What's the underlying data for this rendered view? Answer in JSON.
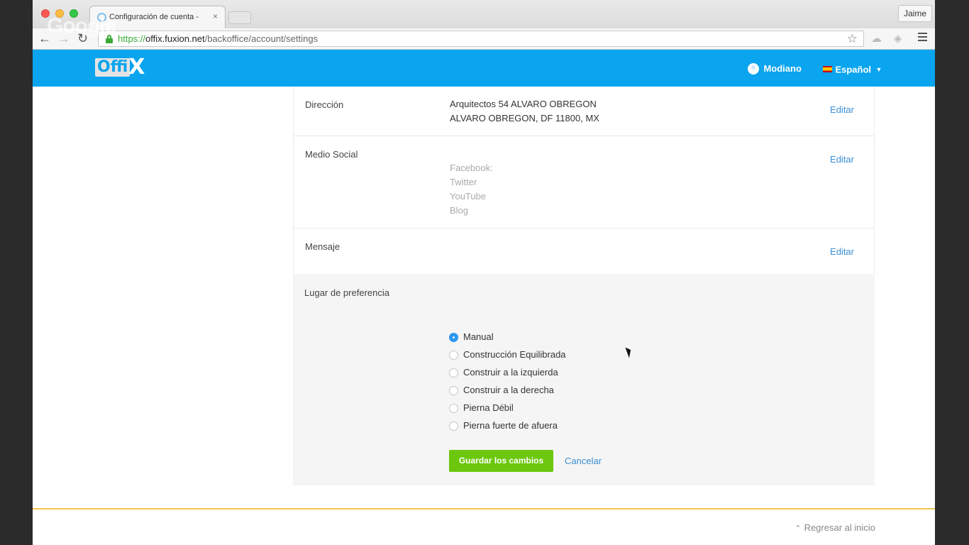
{
  "browser": {
    "tab_title": "Configuración de cuenta -",
    "tab_close": "×",
    "profile_name": "Jaime",
    "url_scheme": "https://",
    "url_host": "offix.fuxion.net",
    "url_path": "/backoffice/account/settings",
    "icons": [
      "back-icon",
      "forward-icon",
      "reload-icon",
      "lock-icon",
      "star-icon",
      "menu-icon"
    ]
  },
  "watermark": "Google",
  "header": {
    "logo_text_a": "Offi",
    "logo_text_b": "X",
    "user_name": "Modiano",
    "language": "Español",
    "accent_color": "#0aa4ef"
  },
  "account": {
    "address": {
      "label": "Dirección",
      "line1": "Arquitectos 54 ALVARO OBREGON",
      "line2": "ALVARO OBREGON, DF 11800, MX",
      "edit": "Editar"
    },
    "social": {
      "label": "Medio Social",
      "items": [
        "Facebook:",
        "Twitter",
        "YouTube",
        "Blog"
      ],
      "edit": "Editar"
    },
    "message": {
      "label": "Mensaje",
      "edit": "Editar"
    },
    "preference": {
      "label": "Lugar de preferencia",
      "options": [
        {
          "label": "Manual",
          "selected": true
        },
        {
          "label": "Construcción Equilibrada",
          "selected": false
        },
        {
          "label": "Construir a la izquierda",
          "selected": false
        },
        {
          "label": "Construir a la derecha",
          "selected": false
        },
        {
          "label": "Pierna Débil",
          "selected": false
        },
        {
          "label": "Pierna fuerte de afuera",
          "selected": false
        }
      ],
      "save": "Guardar los cambios",
      "cancel": "Cancelar",
      "save_color": "#6cc70e"
    }
  },
  "footer": {
    "back_to_top": "Regresar al inicio"
  }
}
